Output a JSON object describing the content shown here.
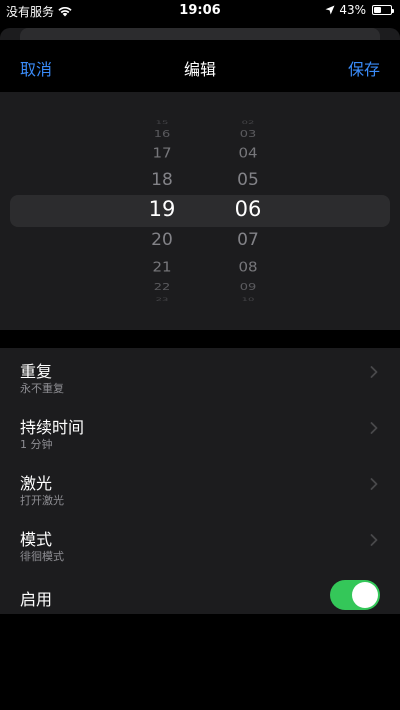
{
  "status_bar": {
    "carrier": "没有服务",
    "time": "19:06",
    "battery_percent": "43%",
    "battery_level": 0.43
  },
  "nav": {
    "cancel_label": "取消",
    "title": "编辑",
    "save_label": "保存"
  },
  "picker": {
    "hours": [
      "15",
      "16",
      "17",
      "18",
      "19",
      "20",
      "21",
      "22",
      "23"
    ],
    "minutes": [
      "02",
      "03",
      "04",
      "05",
      "06",
      "07",
      "08",
      "09",
      "10"
    ],
    "selected_hour": "19",
    "selected_minute": "06"
  },
  "settings": {
    "repeat": {
      "title": "重复",
      "value": "永不重复"
    },
    "duration": {
      "title": "持续时间",
      "value": "1 分钟"
    },
    "laser": {
      "title": "激光",
      "value": "打开激光"
    },
    "mode": {
      "title": "模式",
      "value": "徘徊模式"
    },
    "enable": {
      "title": "启用",
      "on": true
    }
  },
  "colors": {
    "accent": "#3a8bf8",
    "toggle_on": "#34c759",
    "background": "#000000",
    "sheet": "#1c1c1e",
    "secondary_text": "#8e8e93"
  }
}
